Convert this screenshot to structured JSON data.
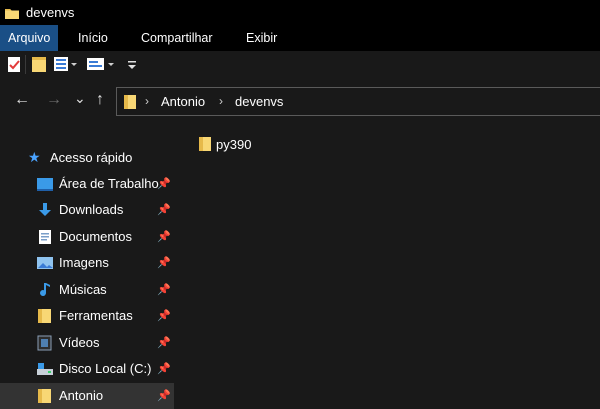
{
  "window": {
    "title": "devenvs"
  },
  "ribbon": {
    "tabs": [
      "Arquivo",
      "Início",
      "Compartilhar",
      "Exibir"
    ]
  },
  "qat": {
    "items": [
      "properties-icon",
      "new-folder-icon",
      "layout-icon",
      "details-pane-icon",
      "customize-icon"
    ]
  },
  "nav": {
    "back_glyph": "←",
    "forward_glyph": "→",
    "recent_glyph": "⌄",
    "up_glyph": "↑"
  },
  "address": {
    "crumbs": [
      "Antonio",
      "devenvs"
    ],
    "separator": "›"
  },
  "sidebar": {
    "quick_access_label": "Acesso rápido",
    "items": [
      {
        "label": "Área de Trabalho",
        "icon": "desktop-icon",
        "pinned": true
      },
      {
        "label": "Downloads",
        "icon": "download-icon",
        "pinned": true
      },
      {
        "label": "Documentos",
        "icon": "document-icon",
        "pinned": true
      },
      {
        "label": "Imagens",
        "icon": "pictures-icon",
        "pinned": true
      },
      {
        "label": "Músicas",
        "icon": "music-icon",
        "pinned": true
      },
      {
        "label": "Ferramentas",
        "icon": "folder-icon",
        "pinned": true
      },
      {
        "label": "Vídeos",
        "icon": "video-icon",
        "pinned": true
      },
      {
        "label": "Disco Local (C:)",
        "icon": "drive-icon",
        "pinned": true
      },
      {
        "label": "Antonio",
        "icon": "folder-icon",
        "pinned": true,
        "selected": true
      }
    ]
  },
  "content": {
    "files": [
      {
        "name": "py390",
        "icon": "folder-icon"
      }
    ]
  },
  "colors": {
    "background": "#191919",
    "titlebar": "#000000",
    "active_tab": "#1a4f86",
    "folder": "#f8d775",
    "accent": "#4aa3ff"
  }
}
